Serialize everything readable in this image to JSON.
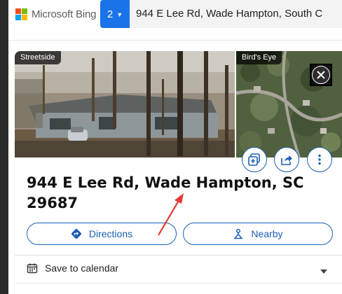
{
  "header": {
    "brand": "Microsoft Bing",
    "brand_colors": [
      "#f25022",
      "#7fba00",
      "#00a4ef",
      "#ffb900"
    ],
    "badge_number": "2",
    "search_query": "944 E Lee Rd, Wade Hampton, South C"
  },
  "card": {
    "photo_tag": "Streetside",
    "aerial_tag": "Bird's Eye",
    "title": "944 E Lee Rd, Wade Hampton, SC 29687",
    "actions": [
      {
        "label": "Directions",
        "icon": "directions-icon"
      },
      {
        "label": "Nearby",
        "icon": "nearby-icon"
      }
    ],
    "calendar_label": "Save to calendar",
    "accent_color": "#1a5fb4"
  }
}
